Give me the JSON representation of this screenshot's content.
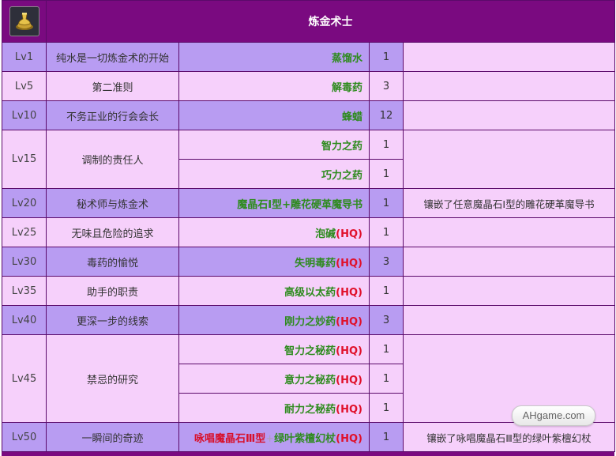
{
  "header": {
    "title": "炼金术士",
    "icon": "alchemy-flask-icon"
  },
  "rows": [
    {
      "level": "Lv1",
      "task": "纯水是一切炼金术的开始",
      "item": "蒸馏水",
      "qty": "1",
      "note": ""
    },
    {
      "level": "Lv5",
      "task": "第二准则",
      "item": "解毒药",
      "qty": "3",
      "note": ""
    },
    {
      "level": "Lv10",
      "task": "不务正业的行会会长",
      "item": "蜂蜡",
      "qty": "12",
      "note": ""
    },
    {
      "level": "Lv15",
      "task": "调制的责任人",
      "items": [
        {
          "item": "智力之药",
          "qty": "1"
        },
        {
          "item": "巧力之药",
          "qty": "1"
        }
      ]
    },
    {
      "level": "Lv20",
      "task": "秘术师与炼金术",
      "item_a": "魔晶石Ⅰ型",
      "plus": "+",
      "item_b": "雕花硬革魔导书",
      "qty": "1",
      "note": "镶嵌了任意魔晶石Ⅰ型的雕花硬革魔导书"
    },
    {
      "level": "Lv25",
      "task": "无味且危险的追求",
      "item": "泡碱",
      "hq": "(HQ)",
      "qty": "1",
      "note": ""
    },
    {
      "level": "Lv30",
      "task": "毒药的愉悦",
      "item": "失明毒药",
      "hq": "(HQ)",
      "qty": "3",
      "note": ""
    },
    {
      "level": "Lv35",
      "task": "助手的职责",
      "item": "高级以太药",
      "hq": "(HQ)",
      "qty": "1",
      "note": ""
    },
    {
      "level": "Lv40",
      "task": "更深一步的线索",
      "item": "刚力之妙药",
      "hq": "(HQ)",
      "qty": "3",
      "note": ""
    },
    {
      "level": "Lv45",
      "task": "禁忌的研究",
      "items": [
        {
          "item": "智力之秘药",
          "hq": "(HQ)",
          "qty": "1"
        },
        {
          "item": "意力之秘药",
          "hq": "(HQ)",
          "qty": "1"
        },
        {
          "item": "耐力之秘药",
          "hq": "(HQ)",
          "qty": "1"
        }
      ]
    },
    {
      "level": "Lv50",
      "task": "一瞬间的奇迹",
      "item_a": "咏唱魔晶石Ⅲ型",
      "plus": "+",
      "item_b": "绿叶紫檀幻杖",
      "hq": "(HQ)",
      "qty": "1",
      "note": "镶嵌了咏唱魔晶石Ⅲ型的绿叶紫檀幻杖"
    }
  ],
  "watermark": "AHgame.com",
  "colors": {
    "header": "#7a0a80",
    "row_purple": "#b89cf2",
    "row_pink": "#f6d0fb",
    "item_green": "#2e8b1e",
    "hq_red": "#e0102a"
  }
}
